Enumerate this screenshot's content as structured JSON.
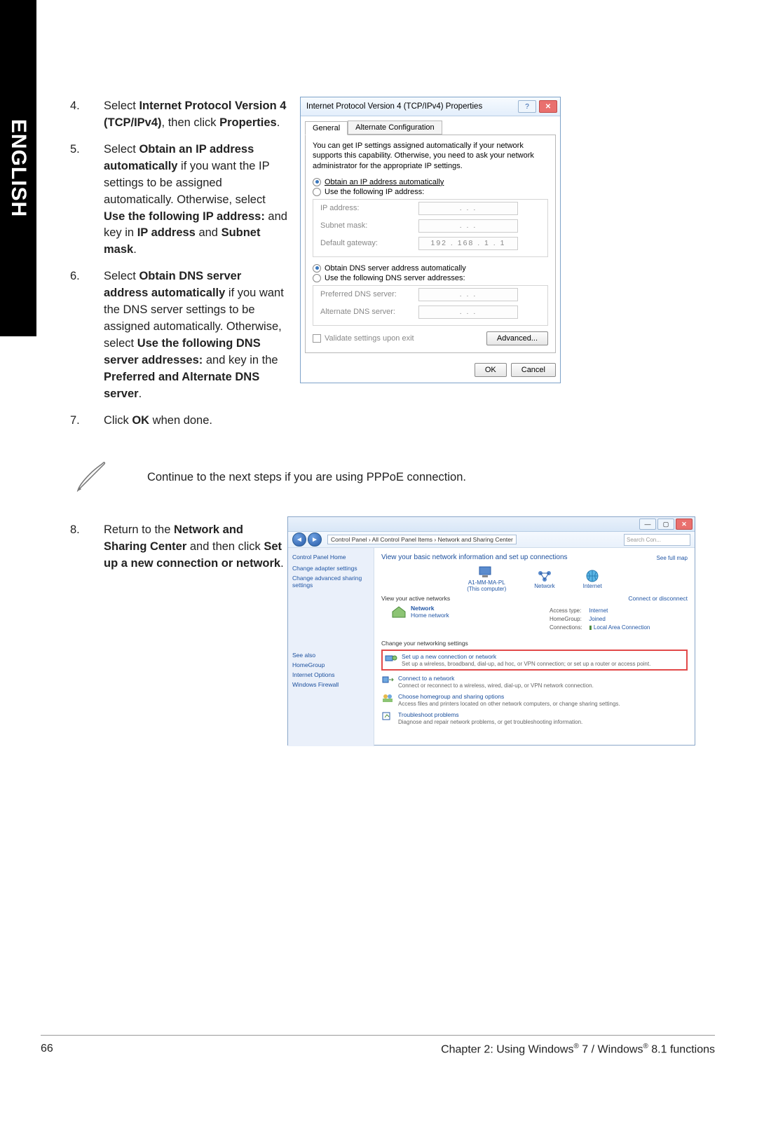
{
  "language_tab": "ENGLISH",
  "steps": {
    "s4": {
      "num": "4.",
      "pre": "Select ",
      "bold1": "Internet Protocol Version 4 (TCP/IPv4)",
      "mid": ", then click ",
      "bold2": "Properties",
      "end": "."
    },
    "s5": {
      "num": "5.",
      "pre": "Select ",
      "bold1": "Obtain an IP address automatically",
      "mid1": " if you want the IP settings to be assigned automatically. Otherwise, select ",
      "bold2": "Use the following IP address:",
      "mid2": " and key in ",
      "bold3": "IP address",
      "mid3": " and ",
      "bold4": "Subnet mask",
      "end": "."
    },
    "s6": {
      "num": "6.",
      "pre": "Select ",
      "bold1": "Obtain DNS server address automatically",
      "mid1": " if you want the DNS server settings to be assigned automatically. Otherwise, select ",
      "bold2": "Use the following DNS server addresses:",
      "mid2": " and key in the ",
      "bold3": "Preferred and Alternate DNS server",
      "end": "."
    },
    "s7": {
      "num": "7.",
      "pre": "Click ",
      "bold1": "OK",
      "end": " when done."
    },
    "s8": {
      "num": "8.",
      "pre": "Return to the ",
      "bold1": "Network and Sharing Center",
      "mid1": " and then click ",
      "bold2": "Set up a new connection or network",
      "end": "."
    }
  },
  "note_text": "Continue to the next steps if you are using PPPoE connection.",
  "ipv4": {
    "title": "Internet Protocol Version 4 (TCP/IPv4) Properties",
    "tab_general": "General",
    "tab_alt": "Alternate Configuration",
    "intro": "You can get IP settings assigned automatically if your network supports this capability. Otherwise, you need to ask your network administrator for the appropriate IP settings.",
    "radio_obtain_ip": "Obtain an IP address automatically",
    "radio_use_ip": "Use the following IP address:",
    "label_ip": "IP address:",
    "label_subnet": "Subnet mask:",
    "label_gateway": "Default gateway:",
    "val_ip": ".   .   .",
    "val_subnet": ".   .   .",
    "val_gateway": "192 . 168 .  1  .  1",
    "radio_obtain_dns": "Obtain DNS server address automatically",
    "radio_use_dns": "Use the following DNS server addresses:",
    "label_pref_dns": "Preferred DNS server:",
    "label_alt_dns": "Alternate DNS server:",
    "val_pref_dns": ".   .   .",
    "val_alt_dns": ".   .   .",
    "validate_label": "Validate settings upon exit",
    "btn_advanced": "Advanced...",
    "btn_ok": "OK",
    "btn_cancel": "Cancel"
  },
  "nsc": {
    "breadcrumb": "Control Panel  ›  All Control Panel Items  ›  Network and Sharing Center",
    "search_placeholder": "Search Con...",
    "side_home": "Control Panel Home",
    "side_adapter": "Change adapter settings",
    "side_sharing": "Change advanced sharing settings",
    "side_seealso": "See also",
    "side_homegroup": "HomeGroup",
    "side_internet": "Internet Options",
    "side_firewall": "Windows Firewall",
    "heading": "View your basic network information and set up connections",
    "fullmap": "See full map",
    "node_pc": "A1-MM-MA-PL",
    "node_pc_sub": "(This computer)",
    "node_net": "Network",
    "node_internet": "Internet",
    "active_hdr": "View your active networks",
    "connect_link": "Connect or disconnect",
    "net_name": "Network",
    "net_type": "Home network",
    "detail_access_lbl": "Access type:",
    "detail_access_val": "Internet",
    "detail_hg_lbl": "HomeGroup:",
    "detail_hg_val": "Joined",
    "detail_conn_lbl": "Connections:",
    "detail_conn_val": "Local Area Connection",
    "change_hdr": "Change your networking settings",
    "task1_title": "Set up a new connection or network",
    "task1_desc": "Set up a wireless, broadband, dial-up, ad hoc, or VPN connection; or set up a router or access point.",
    "task2_title": "Connect to a network",
    "task2_desc": "Connect or reconnect to a wireless, wired, dial-up, or VPN network connection.",
    "task3_title": "Choose homegroup and sharing options",
    "task3_desc": "Access files and printers located on other network computers, or change sharing settings.",
    "task4_title": "Troubleshoot problems",
    "task4_desc": "Diagnose and repair network problems, or get troubleshooting information."
  },
  "footer": {
    "page": "66",
    "chapter_pre": "Chapter 2: Using Windows",
    "reg": "®",
    "mid": " 7 / Windows",
    "end": " 8.1 functions"
  }
}
